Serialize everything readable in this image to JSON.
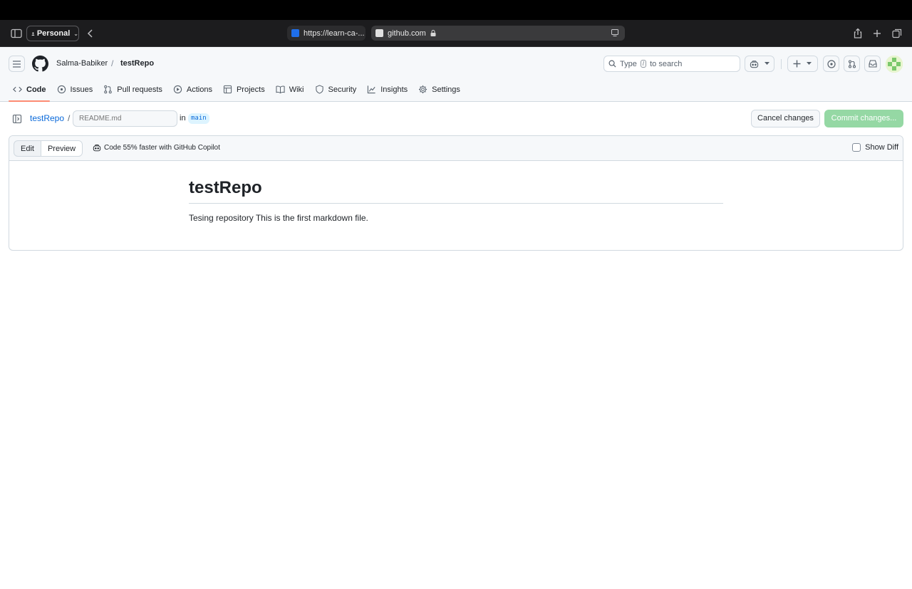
{
  "browser": {
    "profile_label": "Personal",
    "tabs": [
      {
        "label": "https://learn-ca-...",
        "favicon_color": "#1f6feb"
      },
      {
        "label": "github.com",
        "favicon_color": "#e0e0e0"
      }
    ]
  },
  "header": {
    "owner": "Salma-Babiker",
    "separator": "/",
    "repo": "testRepo",
    "search": {
      "prefix": "Type",
      "key": "/",
      "suffix": "to search"
    }
  },
  "nav": {
    "items": [
      {
        "label": "Code",
        "icon": "code-icon"
      },
      {
        "label": "Issues",
        "icon": "issue-icon"
      },
      {
        "label": "Pull requests",
        "icon": "pull-request-icon"
      },
      {
        "label": "Actions",
        "icon": "play-icon"
      },
      {
        "label": "Projects",
        "icon": "table-icon"
      },
      {
        "label": "Wiki",
        "icon": "book-icon"
      },
      {
        "label": "Security",
        "icon": "shield-icon"
      },
      {
        "label": "Insights",
        "icon": "graph-icon"
      },
      {
        "label": "Settings",
        "icon": "gear-icon"
      }
    ]
  },
  "file": {
    "repo": "testRepo",
    "slash": "/",
    "filename_placeholder": "README.md",
    "in_label": "in",
    "branch": "main"
  },
  "actions": {
    "cancel_label": "Cancel changes",
    "commit_label": "Commit changes..."
  },
  "editor": {
    "edit_label": "Edit",
    "preview_label": "Preview",
    "copilot_label": "Code 55% faster with GitHub Copilot",
    "show_diff_label": "Show Diff"
  },
  "preview": {
    "heading": "testRepo",
    "paragraph": "Tesing repository This is the first markdown file."
  },
  "colors": {
    "accent_link": "#0969da",
    "nav_underline": "#fd8c73",
    "commit_button": "#95d8a4"
  }
}
